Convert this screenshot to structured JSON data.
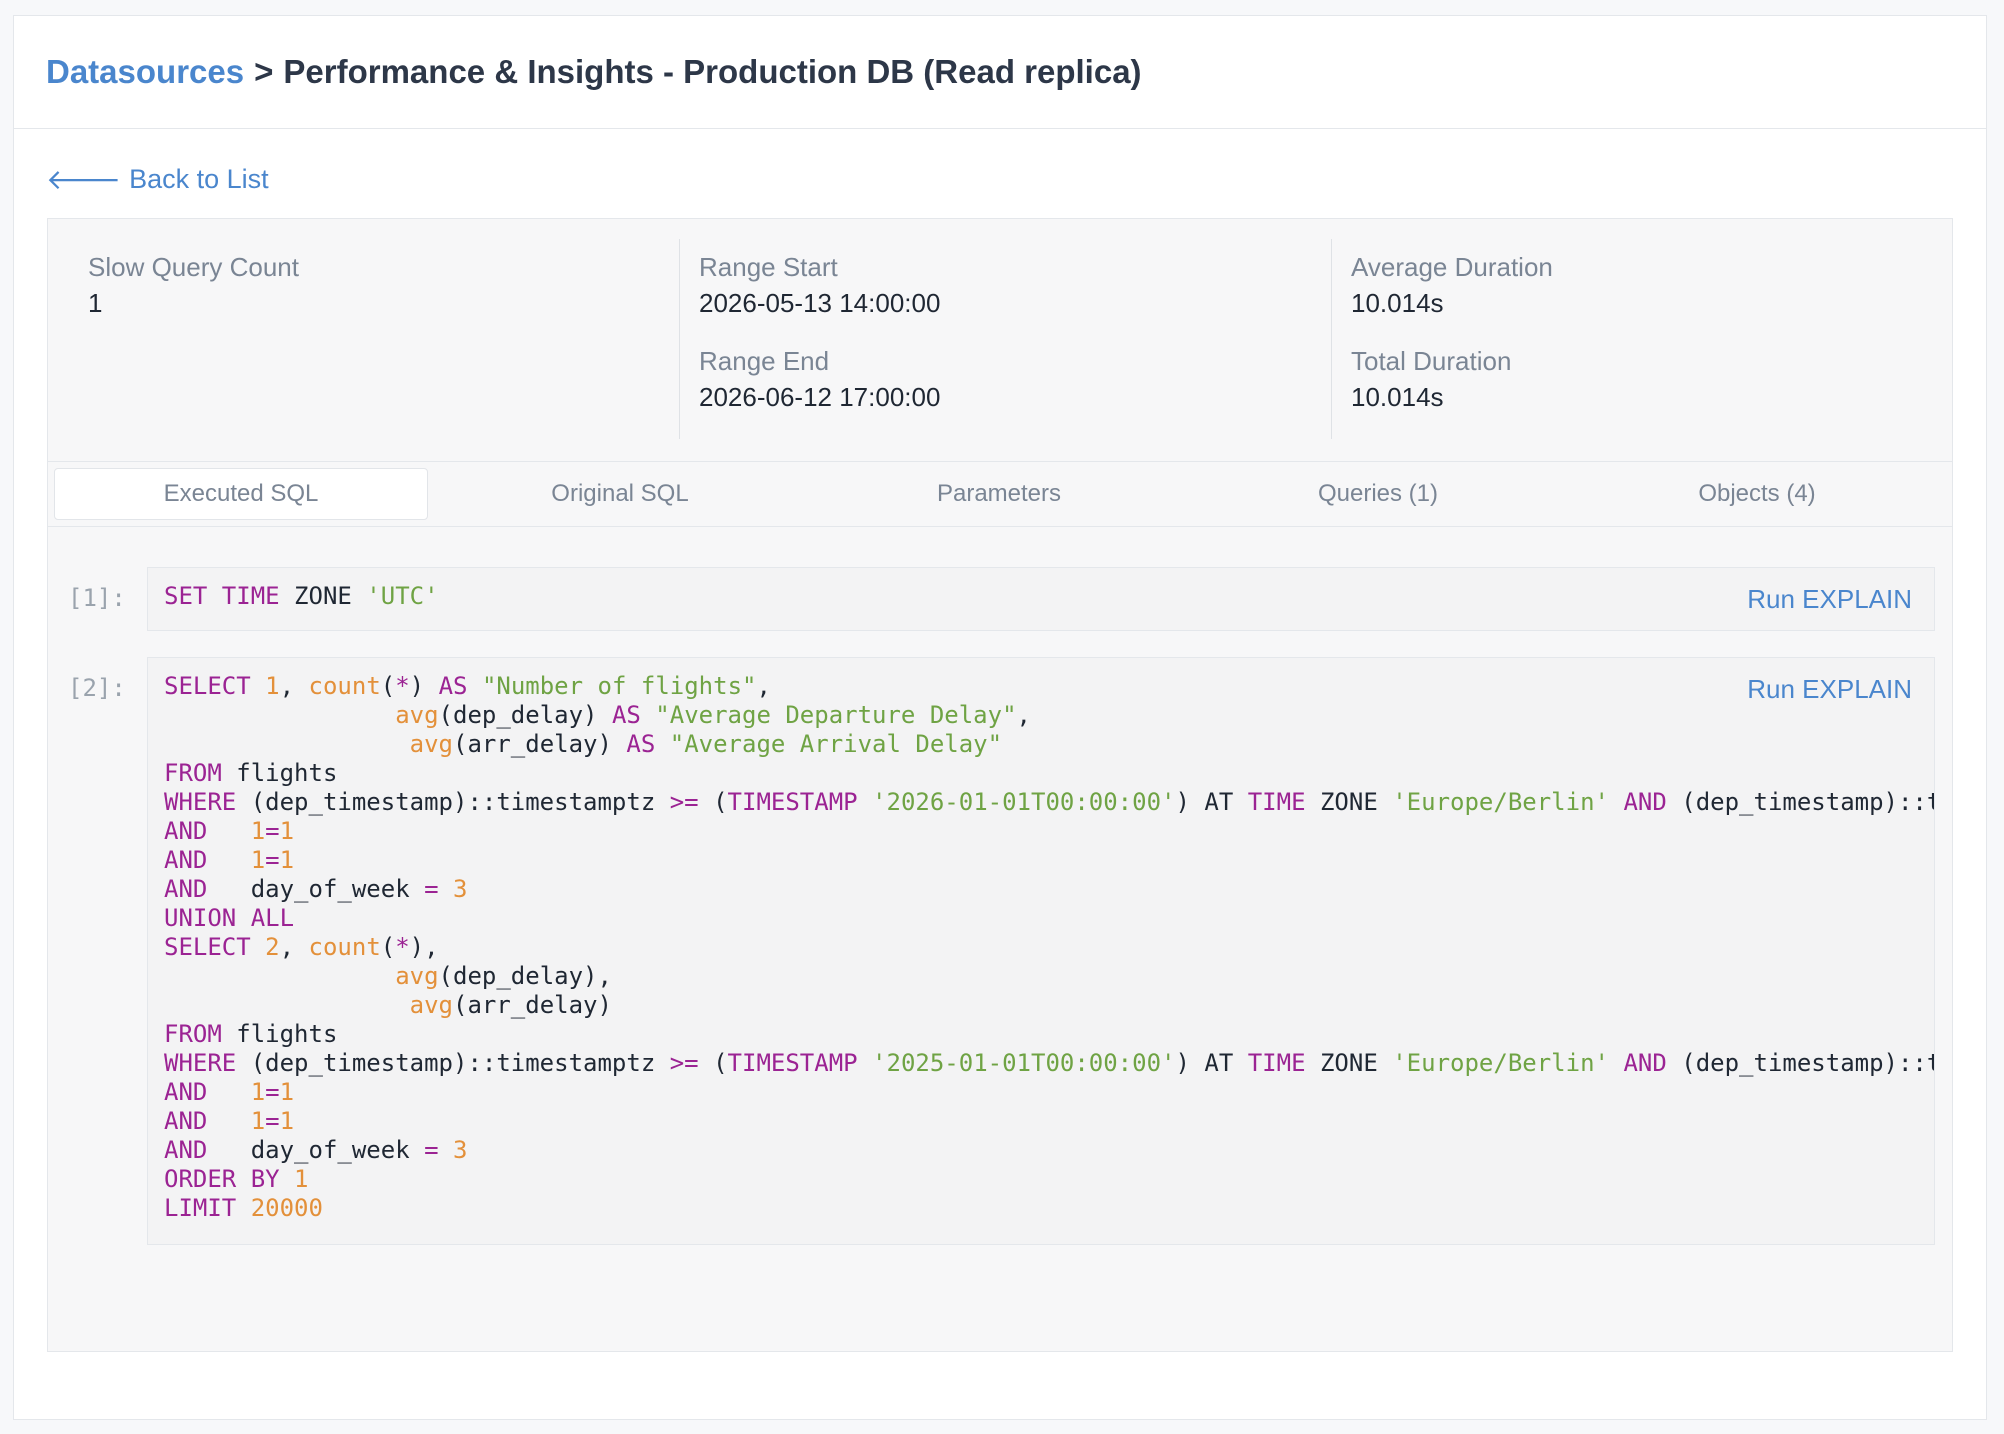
{
  "breadcrumb": {
    "link": "Datasources",
    "separator": ">",
    "current": "Performance & Insights - Production DB (Read replica)"
  },
  "back_link": {
    "arrow": "🡐",
    "label": "Back to List"
  },
  "stats": {
    "slow_query_count": {
      "label": "Slow Query Count",
      "value": "1"
    },
    "range_start": {
      "label": "Range Start",
      "value": "2026-05-13 14:00:00"
    },
    "range_end": {
      "label": "Range End",
      "value": "2026-06-12 17:00:00"
    },
    "average_duration": {
      "label": "Average Duration",
      "value": "10.014s"
    },
    "total_duration": {
      "label": "Total Duration",
      "value": "10.014s"
    }
  },
  "tabs": [
    "Executed SQL",
    "Original SQL",
    "Parameters",
    "Queries (1)",
    "Objects (4)"
  ],
  "active_tab": "Executed SQL",
  "cells": [
    {
      "number": "[1]:",
      "action": "Run EXPLAIN",
      "lines": [
        [
          [
            "kw",
            "SET TIME"
          ],
          [
            "t",
            " ZONE "
          ],
          [
            "str",
            "'UTC'"
          ]
        ]
      ]
    },
    {
      "number": "[2]:",
      "action": "Run EXPLAIN",
      "lines": [
        [
          [
            "kw",
            "SELECT"
          ],
          [
            "t",
            " "
          ],
          [
            "num",
            "1"
          ],
          [
            "t",
            ", "
          ],
          [
            "fn",
            "count"
          ],
          [
            "t",
            "("
          ],
          [
            "kw",
            "*"
          ],
          [
            "t",
            ") "
          ],
          [
            "kw",
            "AS"
          ],
          [
            "t",
            " "
          ],
          [
            "str",
            "\"Number of flights\""
          ],
          [
            "t",
            ","
          ]
        ],
        [
          [
            "t",
            "                "
          ],
          [
            "fn",
            "avg"
          ],
          [
            "t",
            "(dep_delay) "
          ],
          [
            "kw",
            "AS"
          ],
          [
            "t",
            " "
          ],
          [
            "str",
            "\"Average Departure Delay\""
          ],
          [
            "t",
            ","
          ]
        ],
        [
          [
            "t",
            "                 "
          ],
          [
            "fn",
            "avg"
          ],
          [
            "t",
            "(arr_delay) "
          ],
          [
            "kw",
            "AS"
          ],
          [
            "t",
            " "
          ],
          [
            "str",
            "\"Average Arrival Delay\""
          ]
        ],
        [
          [
            "kw",
            "FROM"
          ],
          [
            "t",
            " flights"
          ]
        ],
        [
          [
            "kw",
            "WHERE"
          ],
          [
            "t",
            " (dep_timestamp)::timestamptz "
          ],
          [
            "kw",
            ">="
          ],
          [
            "t",
            " ("
          ],
          [
            "kw",
            "TIMESTAMP"
          ],
          [
            "t",
            " "
          ],
          [
            "str",
            "'2026-01-01T00:00:00'"
          ],
          [
            "t",
            ") AT "
          ],
          [
            "kw",
            "TIME"
          ],
          [
            "t",
            " ZONE "
          ],
          [
            "str",
            "'Europe/Berlin'"
          ],
          [
            "t",
            " "
          ],
          [
            "kw",
            "AND"
          ],
          [
            "t",
            " (dep_timestamp)::timestamptz"
          ]
        ],
        [
          [
            "kw",
            "AND"
          ],
          [
            "t",
            "   "
          ],
          [
            "num",
            "1"
          ],
          [
            "kw",
            "="
          ],
          [
            "num",
            "1"
          ]
        ],
        [
          [
            "kw",
            "AND"
          ],
          [
            "t",
            "   "
          ],
          [
            "num",
            "1"
          ],
          [
            "kw",
            "="
          ],
          [
            "num",
            "1"
          ]
        ],
        [
          [
            "kw",
            "AND"
          ],
          [
            "t",
            "   day_of_week "
          ],
          [
            "kw",
            "="
          ],
          [
            "t",
            " "
          ],
          [
            "num",
            "3"
          ]
        ],
        [
          [
            "kw",
            "UNION ALL"
          ]
        ],
        [
          [
            "kw",
            "SELECT"
          ],
          [
            "t",
            " "
          ],
          [
            "num",
            "2"
          ],
          [
            "t",
            ", "
          ],
          [
            "fn",
            "count"
          ],
          [
            "t",
            "("
          ],
          [
            "kw",
            "*"
          ],
          [
            "t",
            "),"
          ]
        ],
        [
          [
            "t",
            "                "
          ],
          [
            "fn",
            "avg"
          ],
          [
            "t",
            "(dep_delay),"
          ]
        ],
        [
          [
            "t",
            "                 "
          ],
          [
            "fn",
            "avg"
          ],
          [
            "t",
            "(arr_delay)"
          ]
        ],
        [
          [
            "kw",
            "FROM"
          ],
          [
            "t",
            " flights"
          ]
        ],
        [
          [
            "kw",
            "WHERE"
          ],
          [
            "t",
            " (dep_timestamp)::timestamptz "
          ],
          [
            "kw",
            ">="
          ],
          [
            "t",
            " ("
          ],
          [
            "kw",
            "TIMESTAMP"
          ],
          [
            "t",
            " "
          ],
          [
            "str",
            "'2025-01-01T00:00:00'"
          ],
          [
            "t",
            ") AT "
          ],
          [
            "kw",
            "TIME"
          ],
          [
            "t",
            " ZONE "
          ],
          [
            "str",
            "'Europe/Berlin'"
          ],
          [
            "t",
            " "
          ],
          [
            "kw",
            "AND"
          ],
          [
            "t",
            " (dep_timestamp)::timestamptz"
          ]
        ],
        [
          [
            "kw",
            "AND"
          ],
          [
            "t",
            "   "
          ],
          [
            "num",
            "1"
          ],
          [
            "kw",
            "="
          ],
          [
            "num",
            "1"
          ]
        ],
        [
          [
            "kw",
            "AND"
          ],
          [
            "t",
            "   "
          ],
          [
            "num",
            "1"
          ],
          [
            "kw",
            "="
          ],
          [
            "num",
            "1"
          ]
        ],
        [
          [
            "kw",
            "AND"
          ],
          [
            "t",
            "   day_of_week "
          ],
          [
            "kw",
            "="
          ],
          [
            "t",
            " "
          ],
          [
            "num",
            "3"
          ]
        ],
        [
          [
            "kw",
            "ORDER BY"
          ],
          [
            "t",
            " "
          ],
          [
            "num",
            "1"
          ]
        ],
        [
          [
            "kw",
            "LIMIT"
          ],
          [
            "t",
            " "
          ],
          [
            "num",
            "20000"
          ]
        ]
      ]
    }
  ],
  "colors": {
    "link": "#4a86cd",
    "keyword": "#9b2393",
    "number": "#e3903a",
    "string": "#6fa344"
  }
}
